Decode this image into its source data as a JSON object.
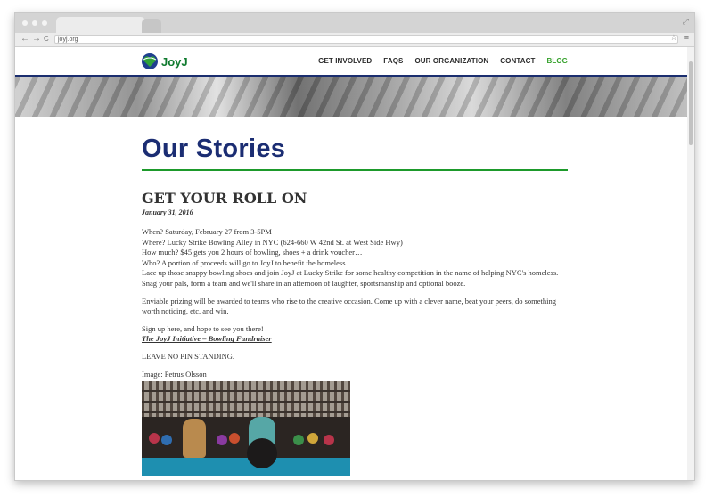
{
  "browser": {
    "url": "joyj.org",
    "back_icon": "←",
    "forward_icon": "→",
    "reload_icon": "C",
    "star_icon": "☆",
    "menu_icon": "≡",
    "resize_icon": "⤢"
  },
  "site": {
    "logo_text": "JoyJ",
    "nav": [
      {
        "label": "GET INVOLVED"
      },
      {
        "label": "FAQS"
      },
      {
        "label": "OUR ORGANIZATION"
      },
      {
        "label": "CONTACT"
      },
      {
        "label": "BLOG"
      }
    ],
    "colors": {
      "brand_green": "#35a12b",
      "navy": "#1b2d73"
    }
  },
  "page": {
    "title": "Our Stories"
  },
  "post": {
    "title": "GET YOUR ROLL ON",
    "date": "January 31, 2016",
    "details": [
      "When? Saturday, February 27 from 3-5PM",
      "Where? Lucky Strike Bowling Alley in NYC (624-660 W 42nd St. at West Side Hwy)",
      "How much? $45 gets you 2 hours of bowling, shoes + a drink voucher…",
      "Who? A portion of proceeds will go to JoyJ to benefit the homeless",
      "Lace up those snappy bowling shoes and join JoyJ at Lucky Strike for some healthy competition in the name of helping NYC's homeless. Snag your pals, form a team and we'll share in an afternoon of laughter, sportsmanship and optional booze."
    ],
    "paragraph2": "Enviable prizing will be awarded to teams who rise to the creative occasion. Come up with a clever name, beat your peers, do something worth noticing, etc. and win.",
    "signup": "Sign up here, and hope to see you there!",
    "link_label": "The JoyJ Initiative – Bowling Fundraiser",
    "closing": "LEAVE NO PIN STANDING.",
    "image_credit": "Image: Petrus Olsson"
  }
}
